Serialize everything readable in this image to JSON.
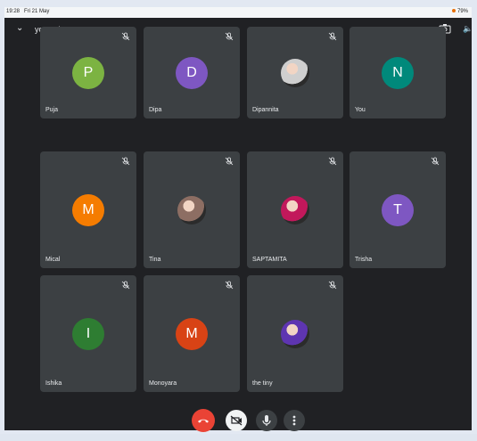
{
  "status": {
    "time": "19:28",
    "date": "Fri 21 May",
    "battery": "79%"
  },
  "meeting": {
    "code": "ycp-pchy-oax"
  },
  "participants": [
    {
      "name": "Puja",
      "initial": "P",
      "color": "#7cb342",
      "type": "initial"
    },
    {
      "name": "Dipa",
      "initial": "D",
      "color": "#7e57c2",
      "type": "initial"
    },
    {
      "name": "Dipannita",
      "initial": "",
      "color": "#cfcfcf",
      "type": "photo"
    },
    {
      "name": "You",
      "initial": "N",
      "color": "#00897b",
      "type": "initial"
    },
    {
      "name": "Mical",
      "initial": "M",
      "color": "#f57c00",
      "type": "initial"
    },
    {
      "name": "Tina",
      "initial": "",
      "color": "#8d6e63",
      "type": "photo"
    },
    {
      "name": "SAPTAMITA",
      "initial": "",
      "color": "#c2185b",
      "type": "photo"
    },
    {
      "name": "Trisha",
      "initial": "T",
      "color": "#7e57c2",
      "type": "initial"
    },
    {
      "name": "Ishika",
      "initial": "I",
      "color": "#2e7d32",
      "type": "initial"
    },
    {
      "name": "Monoyara",
      "initial": "M",
      "color": "#d84315",
      "type": "initial"
    },
    {
      "name": "the tiny",
      "initial": "",
      "color": "#5e35b1",
      "type": "photo"
    }
  ],
  "controls": {
    "end_call": "end-call",
    "camera": "camera-off",
    "mic": "mic",
    "more": "more"
  },
  "icons": {
    "chevron": "chevron-down-icon",
    "mic_off": "mic-off-icon",
    "switch_camera": "switch-camera-icon",
    "speaker": "speaker-icon"
  }
}
